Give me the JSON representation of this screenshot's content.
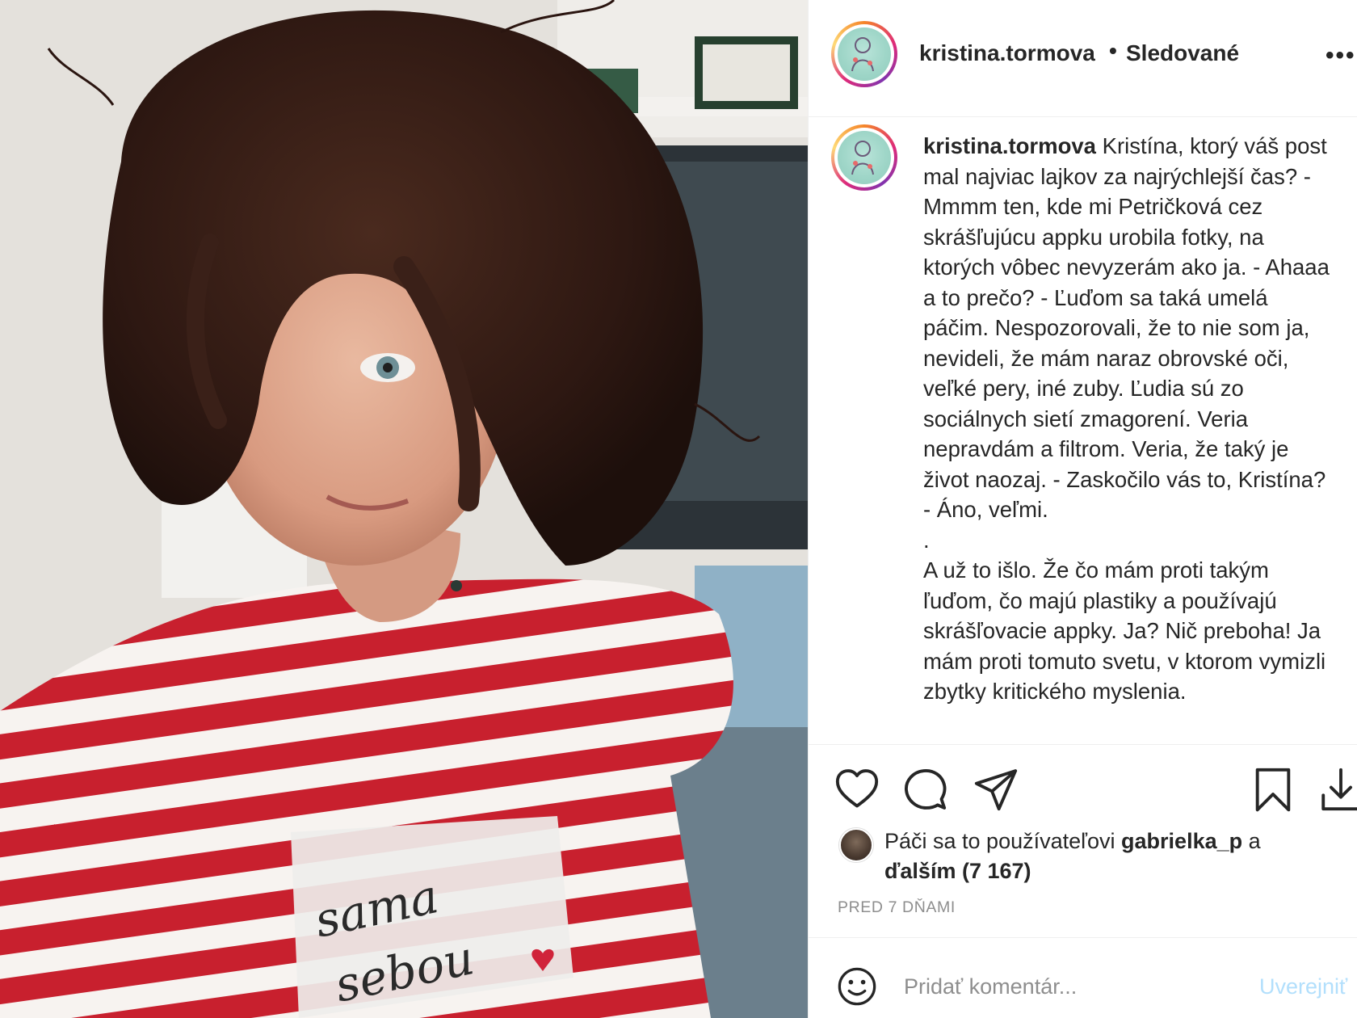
{
  "post": {
    "username": "kristina.tormova",
    "dot": "•",
    "follow_status": "Sledované",
    "more": "•••"
  },
  "photo": {
    "shirt_print_line1": "sama",
    "shirt_print_line2": "sebou"
  },
  "caption": {
    "username": "kristina.tormova",
    "text": " Kristína, ktorý váš post mal najviac lajkov za najrýchlejší čas? - Mmmm ten, kde mi Petričková cez skrášľujúcu appku urobila fotky, na ktorých vôbec nevyzerám ako ja. - Ahaaa a to prečo? - Ľuďom sa taká umelá páčim. Nespozorovali, že to nie som ja, nevideli, že mám naraz obrovské oči, veľké pery, iné zuby. Ľudia sú zo sociálnych sietí zmagorení. Veria nepravdám a filtrom. Veria, že taký je život naozaj. - Zaskočilo vás to, Kristína? - Áno, veľmi.\n.\nA už to išlo. Že čo mám proti takým ľuďom, čo majú plastiky a používajú skrášľovacie appky. Ja? Nič preboha! Ja mám proti tomuto svetu, v ktorom vymizli zbytky kritického myslenia."
  },
  "actions": {
    "like": "heart-icon",
    "comment": "comment-icon",
    "share": "paper-plane-icon",
    "save": "bookmark-icon",
    "download": "download-icon"
  },
  "likes": {
    "prefix": "Páči sa to používateľovi ",
    "user": "gabrielka_p",
    "middle": " a ",
    "others": "ďalším (7 167)"
  },
  "timestamp": "PRED 7 DŇAMI",
  "comment_box": {
    "placeholder": "Pridať komentár...",
    "post_label": "Uverejniť"
  },
  "colors": {
    "text": "#262626",
    "muted": "#8e8e8e",
    "post_button": "#b2dffc",
    "story_ring": "#dd2a7b",
    "shirt_red": "#c8202e"
  }
}
